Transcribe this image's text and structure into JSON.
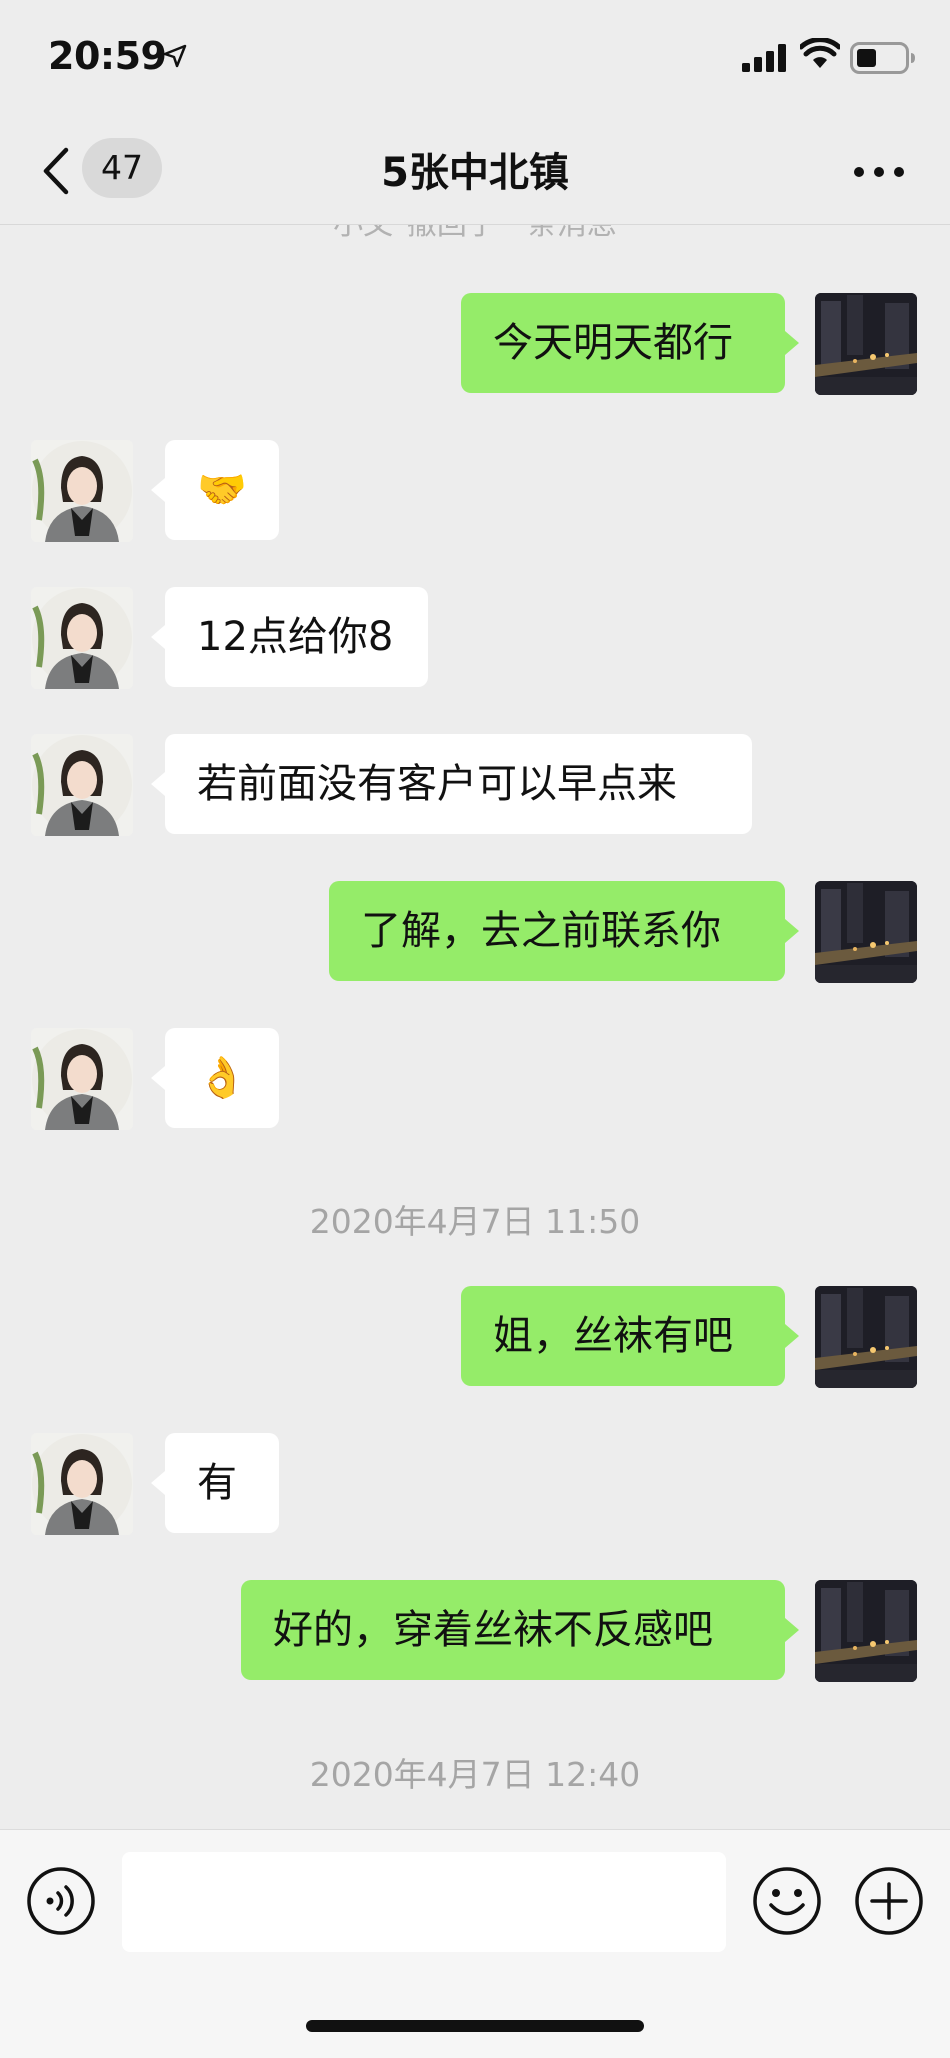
{
  "status_bar": {
    "time": "20:59",
    "battery_level": 0.35
  },
  "nav": {
    "unread_count": "47",
    "title": "5张中北镇"
  },
  "system_notice_partial": "小文\"撤回了一条消息",
  "messages": [
    {
      "side": "self",
      "text": "今天明天都行"
    },
    {
      "side": "other",
      "emoji": "🤝",
      "icon": "handshake-emoji"
    },
    {
      "side": "other",
      "text": "12点给你8"
    },
    {
      "side": "other",
      "text": "若前面没有客户可以早点来"
    },
    {
      "side": "self",
      "text": "了解，去之前联系你"
    },
    {
      "side": "other",
      "emoji": "👌",
      "icon": "ok-hand-emoji"
    }
  ],
  "timestamp_1": "2020年4月7日 11:50",
  "messages_2": [
    {
      "side": "self",
      "text": "姐，丝袜有吧"
    },
    {
      "side": "other",
      "text": "有"
    },
    {
      "side": "self",
      "text": "好的，穿着丝袜不反感吧"
    }
  ],
  "timestamp_2": "2020年4月7日 12:40",
  "input_bar": {
    "placeholder": ""
  },
  "colors": {
    "self_bubble": "#95ec69",
    "other_bubble": "#ffffff",
    "background": "#ededed"
  }
}
